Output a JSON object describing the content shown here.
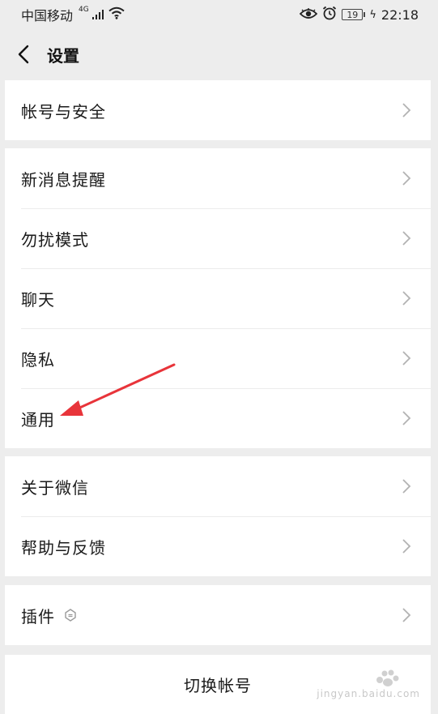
{
  "status_bar": {
    "carrier": "中国移动",
    "network": "4G",
    "battery": "19",
    "time": "22:18"
  },
  "nav": {
    "title": "设置"
  },
  "groups": [
    {
      "items": [
        {
          "label": "帐号与安全"
        }
      ]
    },
    {
      "items": [
        {
          "label": "新消息提醒"
        },
        {
          "label": "勿扰模式"
        },
        {
          "label": "聊天"
        },
        {
          "label": "隐私"
        },
        {
          "label": "通用"
        }
      ]
    },
    {
      "items": [
        {
          "label": "关于微信"
        },
        {
          "label": "帮助与反馈"
        }
      ]
    },
    {
      "items": [
        {
          "label": "插件"
        }
      ]
    }
  ],
  "switch_account": {
    "label": "切换帐号"
  },
  "watermark": {
    "text": "jingyan.baidu.com"
  },
  "colors": {
    "background": "#ededed",
    "card": "#ffffff",
    "annotation_arrow": "#e8343a",
    "chevron": "#b2b2b2"
  },
  "icons": {
    "back": "chevron-left-icon",
    "chevron": "chevron-right-icon",
    "plugin": "plugin-icon",
    "eye": "eye-icon",
    "alarm": "alarm-icon",
    "wifi": "wifi-icon"
  }
}
